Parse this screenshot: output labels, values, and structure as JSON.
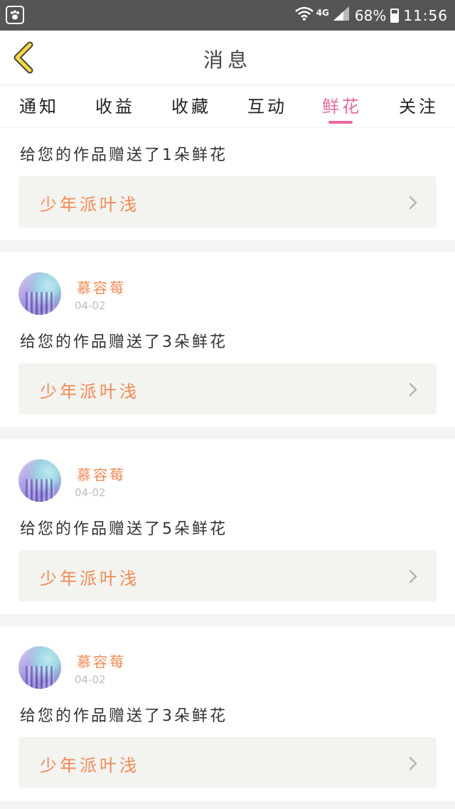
{
  "status_bar": {
    "network": "4G",
    "battery": "68%",
    "time": "11:56",
    "icons": [
      "paw-app-icon",
      "wifi-icon",
      "signal-icon",
      "battery-icon"
    ]
  },
  "header": {
    "title": "消息"
  },
  "tabs": [
    {
      "label": "通知"
    },
    {
      "label": "收益"
    },
    {
      "label": "收藏"
    },
    {
      "label": "互动"
    },
    {
      "label": "鲜花",
      "active": true
    },
    {
      "label": "关注"
    }
  ],
  "messages": [
    {
      "text": "给您的作品赠送了1朵鲜花",
      "work_title": "少年派叶浅"
    },
    {
      "user": "慕容莓",
      "date": "04-02",
      "text": "给您的作品赠送了3朵鲜花",
      "work_title": "少年派叶浅"
    },
    {
      "user": "慕容莓",
      "date": "04-02",
      "text": "给您的作品赠送了5朵鲜花",
      "work_title": "少年派叶浅"
    },
    {
      "user": "慕容莓",
      "date": "04-02",
      "text": "给您的作品赠送了3朵鲜花",
      "work_title": "少年派叶浅"
    }
  ],
  "colors": {
    "accent_pink": "#e46aa0",
    "accent_orange": "#f08a55",
    "back_arrow": "#f5d742"
  }
}
